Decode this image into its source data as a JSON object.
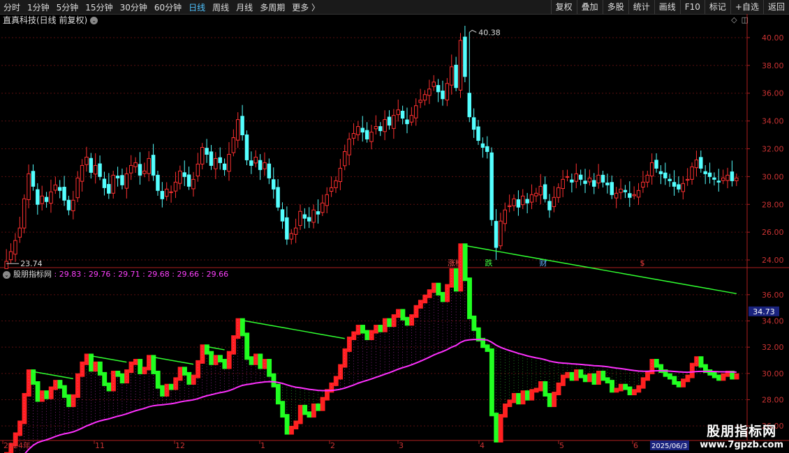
{
  "toolbar": {
    "periods": [
      "分时",
      "1分钟",
      "5分钟",
      "15分钟",
      "30分钟",
      "60分钟",
      "日线",
      "周线",
      "月线",
      "多周期",
      "更多 〉"
    ],
    "active_period": "日线",
    "actions": [
      "复权",
      "叠加",
      "多股",
      "统计",
      "画线",
      "F10",
      "标记",
      "+自选",
      "返回"
    ]
  },
  "main_chart": {
    "title": "直真科技(日线 前复权)",
    "price_axis_labels": [
      "40.00",
      "38.00",
      "36.00",
      "34.00",
      "32.00",
      "30.00",
      "28.00",
      "26.00",
      "24.00"
    ],
    "high_label": "40.38",
    "low_label": "23.74",
    "event_markers": [
      {
        "text": "涨榜",
        "color": "#ff5050"
      },
      {
        "text": "跌",
        "color": "#40ff40"
      },
      {
        "text": "财",
        "color": "#60b0ff"
      },
      {
        "text": "$",
        "color": "#ff4040"
      }
    ],
    "colors": {
      "up": "#ff3030",
      "down": "#54ffff",
      "axis": "#b02020"
    }
  },
  "indicator": {
    "name": "股朋指标网",
    "values": [
      "29.83",
      "29.76",
      "29.71",
      "29.68",
      "29.66",
      "29.66"
    ],
    "axis_labels": [
      "36.00",
      "34.00",
      "32.00",
      "30.00",
      "28.00",
      "26.00"
    ],
    "current_value": "34.73",
    "colors": {
      "up": "#ff2020",
      "down": "#20ff20",
      "ma": "#ff30ff",
      "resistance": "#30ff30"
    }
  },
  "date_axis": {
    "labels": [
      "2024年",
      "11",
      "12",
      "1",
      "2",
      "3",
      "4",
      "5",
      "6"
    ],
    "current": "2025/06/3"
  },
  "chart_data": {
    "type": "candlestick",
    "title": "直真科技(日线 前复权)",
    "ylim": [
      23.5,
      40.8
    ],
    "annotations": {
      "max": 40.38,
      "min": 23.74
    },
    "series": [
      {
        "name": "close",
        "values": [
          23.9,
          24.6,
          25.4,
          26.3,
          28.4,
          30.2,
          29.3,
          28.0,
          28.6,
          28.2,
          28.9,
          29.4,
          29.0,
          28.3,
          27.6,
          28.3,
          29.9,
          30.8,
          31.4,
          30.3,
          30.8,
          30.0,
          29.2,
          28.8,
          30.1,
          29.9,
          29.4,
          30.2,
          30.8,
          31.0,
          30.1,
          30.4,
          31.3,
          30.1,
          29.0,
          28.4,
          29.1,
          28.9,
          29.6,
          30.4,
          30.0,
          29.3,
          29.8,
          30.9,
          32.1,
          31.6,
          30.8,
          31.3,
          31.0,
          30.5,
          31.6,
          32.8,
          34.1,
          33.0,
          31.2,
          30.8,
          31.4,
          30.5,
          31.0,
          29.9,
          29.1,
          27.8,
          26.8,
          25.5,
          25.9,
          26.3,
          27.5,
          27.0,
          26.8,
          27.6,
          27.3,
          28.1,
          28.7,
          29.2,
          29.7,
          30.6,
          31.8,
          32.7,
          33.1,
          33.6,
          33.2,
          32.7,
          33.2,
          33.6,
          33.3,
          34.1,
          33.7,
          34.4,
          34.8,
          34.2,
          33.8,
          34.4,
          35.1,
          35.5,
          35.9,
          36.3,
          36.8,
          36.1,
          35.6,
          36.7,
          37.9,
          36.4,
          39.8,
          37.2,
          34.3,
          33.4,
          32.6,
          32.1,
          31.8,
          26.9,
          24.9,
          26.8,
          27.6,
          27.9,
          28.4,
          27.8,
          28.6,
          28.1,
          28.7,
          28.8,
          29.3,
          28.4,
          27.6,
          28.5,
          29.2,
          29.8,
          30.0,
          29.6,
          30.2,
          29.8,
          29.5,
          29.9,
          29.3,
          30.1,
          29.6,
          29.4,
          28.7,
          28.8,
          29.1,
          28.9,
          28.5,
          28.7,
          29.0,
          29.6,
          30.1,
          31.0,
          30.6,
          30.2,
          29.9,
          29.7,
          29.3,
          29.1,
          29.5,
          29.8,
          30.7,
          31.2,
          30.6,
          30.2,
          30.0,
          29.8,
          29.6,
          29.9,
          30.1,
          29.7,
          29.9
        ]
      }
    ]
  }
}
